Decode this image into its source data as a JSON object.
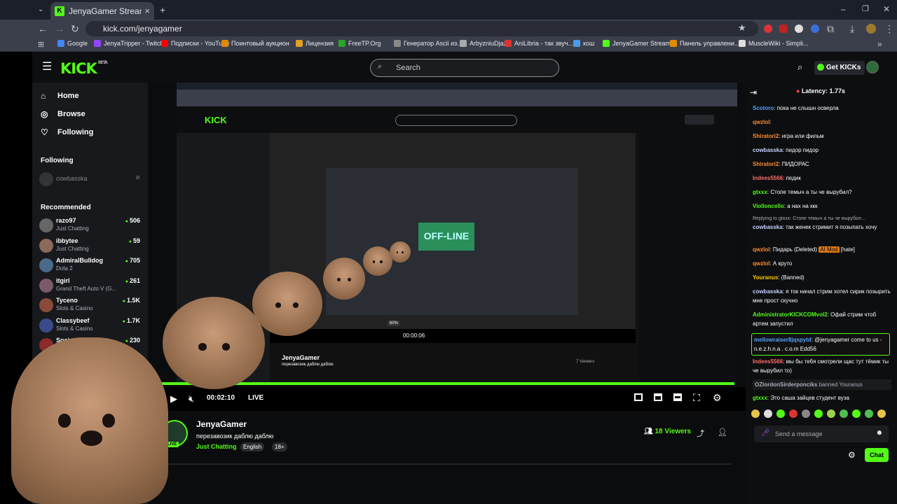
{
  "browser": {
    "tab_title": "JenyaGamer Stream - Watch Li",
    "url": "kick.com/jenyagamer",
    "bookmarks": [
      "Google",
      "JenyaTripper - Twitch",
      "Подписки - YouTube",
      "Поинтовый аукцион",
      "Лицензия",
      "FreeTP.Org",
      "Генератор Ascii из...",
      "ArbyzniuDjazik",
      "AniLibria - так звуч...",
      "кош",
      "JenyaGamer Stream...",
      "Панель управлени...",
      "MuscleWiki - Simpli..."
    ]
  },
  "header": {
    "logo": "KICK",
    "logo_tag": "BETA",
    "search_placeholder": "Search",
    "get_kicks": "Get KICKs"
  },
  "sidebar": {
    "nav": [
      {
        "label": "Home",
        "icon": "home-icon"
      },
      {
        "label": "Browse",
        "icon": "compass-icon"
      },
      {
        "label": "Following",
        "icon": "heart-icon"
      }
    ],
    "following_title": "Following",
    "following": [
      {
        "name": "cowbasska"
      }
    ],
    "recommended_title": "Recommended",
    "recommended": [
      {
        "name": "razo97",
        "category": "Just Chatting",
        "viewers": "506"
      },
      {
        "name": "ibbytee",
        "category": "Just Chatting",
        "viewers": "59"
      },
      {
        "name": "AdmiralBulldog",
        "category": "Dota 2",
        "viewers": "705"
      },
      {
        "name": "itgirl",
        "category": "Grand Theft Auto V (G...",
        "viewers": "261"
      },
      {
        "name": "Tyceno",
        "category": "Slots & Casino",
        "viewers": "1.5K"
      },
      {
        "name": "Classybeef",
        "category": "Slots & Casino",
        "viewers": "1.7K"
      },
      {
        "name": "Sosio",
        "category": "",
        "viewers": "230"
      }
    ]
  },
  "player": {
    "time": "00:02:10",
    "live": "LIVE",
    "volume_label": "60%"
  },
  "stream": {
    "streamer": "JenyaGamer",
    "title": "перезавозик даблю даблю",
    "category": "Just Chatting",
    "tags": [
      "English",
      "18+"
    ],
    "viewers": "18 Viewers",
    "live_badge": "LIVE"
  },
  "inner": {
    "streamer": "JenyaGamer",
    "title": "перезавозик даблю даблю",
    "viewers": "7 Viewers",
    "time": "00:00:06",
    "offline": "OFF-LINE"
  },
  "chat": {
    "latency": "Latency: 1.77s",
    "messages": [
      {
        "user": "Scotoro",
        "color": "#53a3ff",
        "text": "пока не слышн осверла"
      },
      {
        "user": "qwzlol",
        "color": "#ff8c2e",
        "text": ""
      },
      {
        "user": "Shiratori2",
        "color": "#ff8c2e",
        "text": "игра или фильм"
      },
      {
        "user": "cowbasska",
        "color": "#c9d1ff",
        "text": "пидор пидор"
      },
      {
        "user": "Shiratori2",
        "color": "#ff8c2e",
        "text": "ПИДОРАС"
      },
      {
        "user": "Indees5566",
        "color": "#ff6b6b",
        "text": "педик"
      },
      {
        "user": "gtxxx",
        "color": "#53fc18",
        "text": "Стопе темыч а ты че вырубил?"
      },
      {
        "user": "Violloncello",
        "color": "#53fc18",
        "text": "а нах на ккк"
      },
      {
        "user": "",
        "color": "#adadb8",
        "text": "Replying to gtxxx: Стопе темыч а ты че вырубил..."
      },
      {
        "user": "cowbasska",
        "color": "#c9d1ff",
        "text": "так женек стримит я позыпать хочу"
      },
      {
        "user": "qwzlol",
        "color": "#ff8c2e",
        "text": "Пидарь (Deleted)"
      },
      {
        "user": "qwzlol",
        "color": "#ff8c2e",
        "text": "А круто"
      },
      {
        "user": "Youranus",
        "color": "#ffcc00",
        "text": "(Banned)"
      },
      {
        "user": "cowbasska",
        "color": "#c9d1ff",
        "text": "я ток начал стрим хотел сирик позырить мне прост скучно"
      },
      {
        "user": "AdministratorKICKCOMvol2",
        "color": "#53fc18",
        "text": "Офай стрим чтоб артем запустил"
      },
      {
        "user": "mellowraiser8jqspytd",
        "color": "#53a3ff",
        "text": "@jenyagamer come to us - n.e.z.h.n.a . c.o.m Edd56"
      },
      {
        "user": "Indees5566",
        "color": "#ff6b6b",
        "text": "мы бы тебя смотрели щас тут тёмик ты че вырубил то)"
      },
      {
        "user": "OZlordonSirderponciks",
        "color": "#adadb8",
        "text": "banned Youranus"
      },
      {
        "user": "gtxxx",
        "color": "#53fc18",
        "text": "Это саша зайцев студент вуза"
      }
    ],
    "mod_badge": "AI Mod",
    "mod_suffix": "[hate]",
    "input_placeholder": "Send a message",
    "send_label": "Chat"
  },
  "colors": {
    "kick_green": "#53fc18",
    "bg": "#0d0e10",
    "sidebar": "#18191c"
  }
}
